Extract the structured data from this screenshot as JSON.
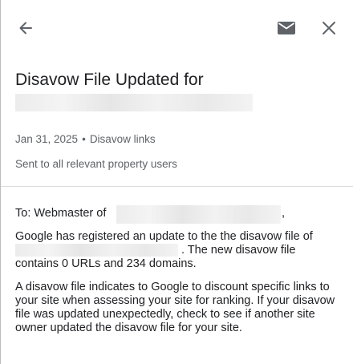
{
  "toolbar": {
    "back_icon": "arrow-left-icon",
    "mail_icon": "envelope-icon",
    "close_icon": "close-icon"
  },
  "email": {
    "subject": "Disavow File Updated for",
    "date": "Jan 31, 2025",
    "separator": "•",
    "category": "Disavow links",
    "recipients_note": "Sent to all relevant property users",
    "to_prefix": "To: Webmaster of",
    "to_suffix": ",",
    "para1_line1": "Google has registered an update to the the disavow file of",
    "para1_line2": ". The new disavow file",
    "para1_line3": "contains 0 URLs and 234 domains.",
    "para2": "A disavow file indicates to Google to discount specific links to your site when assessing your site for ranking. If your disavow file was updated unexpectedly, check to see if another site owner updated the disavow file for your site."
  },
  "colors": {
    "text": "#202124",
    "muted": "#5f6368",
    "icon": "#5f6368",
    "divider": "#dadce0"
  }
}
